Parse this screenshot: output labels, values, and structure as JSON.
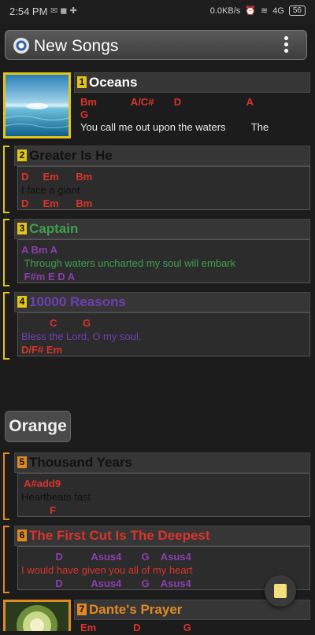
{
  "status": {
    "time": "2:54 PM",
    "net": "0.0KB/s",
    "signal": "4G",
    "battery": "56"
  },
  "appbar": {
    "title": "New Songs"
  },
  "songs": [
    {
      "num": "1",
      "title": "Oceans",
      "title_color": "#ffffff",
      "accent": "#e3c51a",
      "lines": [
        [
          "chord",
          "Bm            A/C#       D                       A"
        ],
        [
          "chord",
          "G"
        ],
        [
          "lyric",
          "You call me out upon the waters         The"
        ]
      ]
    },
    {
      "num": "2",
      "title": "Greater Is He",
      "title_color": "#111111",
      "accent": "#e3c51a",
      "lines": [
        [
          "chord",
          "D     Em      Bm"
        ],
        [
          "lyric",
          "I face a giant"
        ],
        [
          "chord",
          "D     Em      Bm"
        ]
      ]
    },
    {
      "num": "3",
      "title": "Captain",
      "title_color": "#3fa04a",
      "accent": "#e3c51a",
      "lines": [
        [
          "chord",
          "A Bm A"
        ],
        [
          "lyric",
          " Through waters uncharted my soul will embark"
        ],
        [
          "chord",
          " F#m E D A"
        ]
      ]
    },
    {
      "num": "4",
      "title": "10000 Reasons",
      "title_color": "#6e3fb0",
      "accent": "#e3c51a",
      "lines": [
        [
          "chord",
          "          C         G"
        ],
        [
          "lyric",
          "Bless the Lord, O my soul,"
        ],
        [
          "chord",
          "D/F# Em"
        ]
      ]
    },
    {
      "num": "5",
      "title": "Thousand Years",
      "title_color": "#111111",
      "accent": "#e08a24",
      "lines": [
        [
          "chord",
          " A#add9"
        ],
        [
          "lyric",
          "Heartbeats fast"
        ],
        [
          "chord",
          "          F"
        ]
      ]
    },
    {
      "num": "6",
      "title": "The First Cut Is The Deepest",
      "title_color": "#d9342b",
      "accent": "#e08a24",
      "lines": [
        [
          "chord",
          "            D          Asus4       G    Asus4"
        ],
        [
          "lyric",
          "I would have given you all of my heart"
        ],
        [
          "chord",
          "            D          Asus4       G    Asus4"
        ]
      ]
    },
    {
      "num": "7",
      "title": "Dante's Prayer",
      "title_color": "#e08a24",
      "accent": "#e08a24",
      "lines": [
        [
          "chord",
          "Em             D               G"
        ]
      ]
    }
  ],
  "group": {
    "label": "Orange"
  },
  "colors": {
    "chord_default": "#d9342b",
    "song3_chord": "#8a3fb0",
    "song3_lyric": "#3fa04a",
    "song4_lyric": "#6e3fb0",
    "song6_lyric": "#d9342b",
    "song6_chord": "#8a3fb0"
  }
}
